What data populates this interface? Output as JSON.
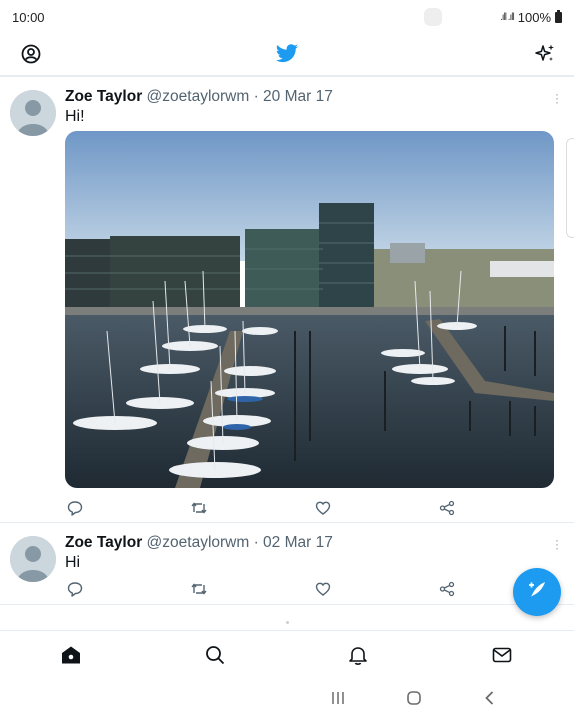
{
  "status_bar": {
    "time": "10:00",
    "battery": "100%",
    "signal": ".ıll .ıll"
  },
  "colors": {
    "brand": "#1d9bf0",
    "text": "#0f1419",
    "secondary": "#536471",
    "divider": "#e6ecf0"
  },
  "top_bar": {
    "left_icon": "profile-icon",
    "center_icon": "twitter-bird-icon",
    "right_icon": "sparkle-icon"
  },
  "tweets": [
    {
      "name": "Zoe Taylor",
      "handle": "@zoetaylorwm",
      "date": "· 20 Mar 17",
      "text": "Hi!",
      "has_media": true
    },
    {
      "name": "Zoe Taylor",
      "handle": "@zoetaylorwm",
      "date": "· 02 Mar 17",
      "text": "Hi",
      "has_media": false
    }
  ],
  "actions": [
    "reply-icon",
    "retweet-icon",
    "like-icon",
    "share-icon"
  ],
  "compose": {
    "icon": "compose-icon"
  },
  "bottom_nav": [
    "home-icon",
    "search-icon",
    "notifications-icon",
    "messages-icon"
  ],
  "system_nav": [
    "recents-icon",
    "home-button-icon",
    "back-icon"
  ]
}
